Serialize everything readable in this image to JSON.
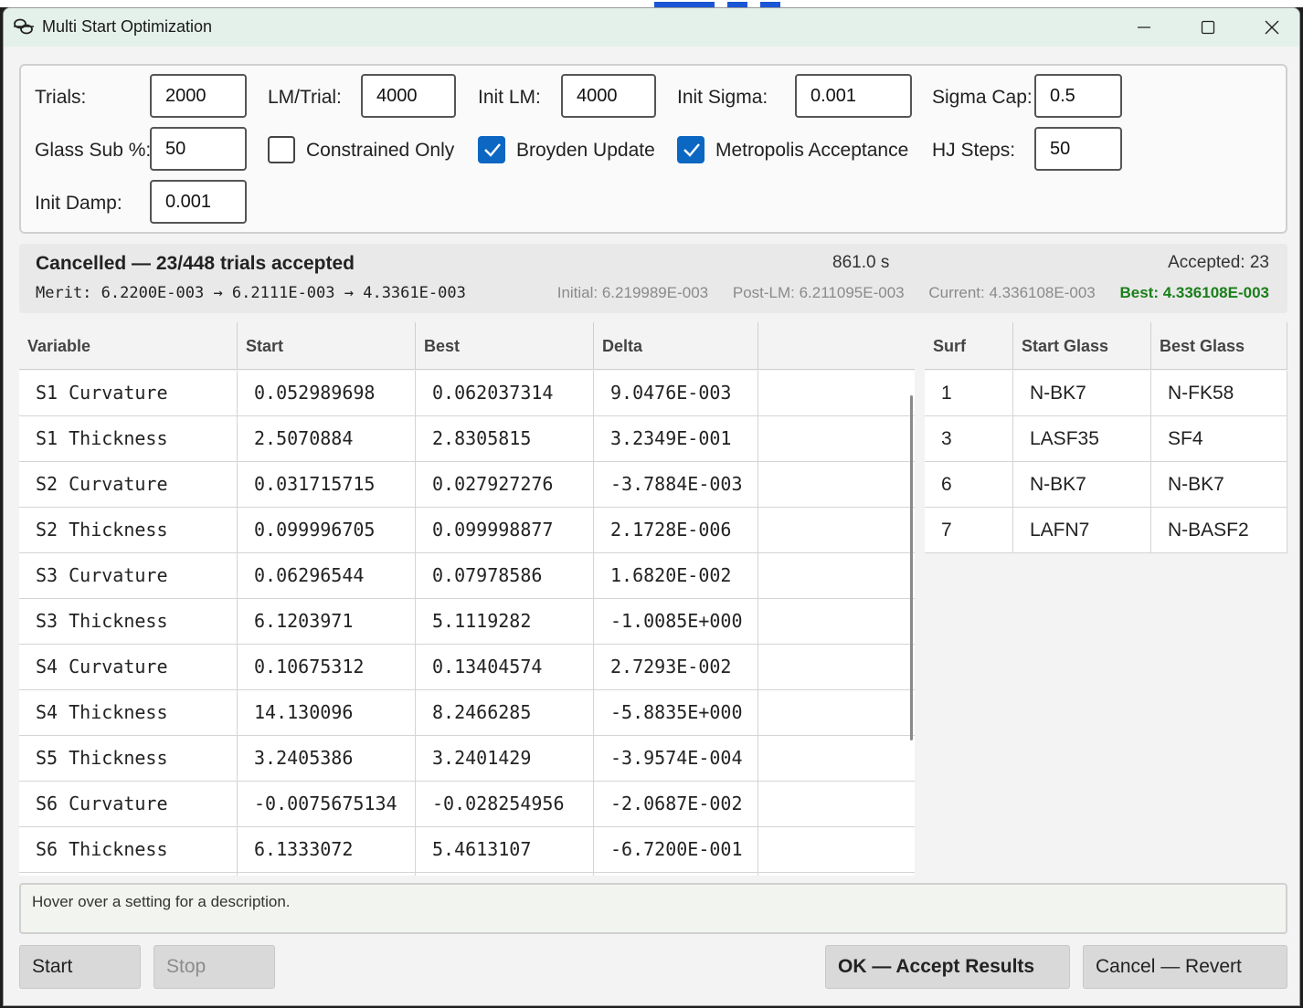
{
  "window": {
    "title": "Multi Start Optimization"
  },
  "settings": {
    "trials_label": "Trials:",
    "trials_value": "2000",
    "lm_trial_label": "LM/Trial:",
    "lm_trial_value": "4000",
    "init_lm_label": "Init LM:",
    "init_lm_value": "4000",
    "init_sigma_label": "Init Sigma:",
    "init_sigma_value": "0.001",
    "sigma_cap_label": "Sigma Cap:",
    "sigma_cap_value": "0.5",
    "glass_sub_label": "Glass Sub %:",
    "glass_sub_value": "50",
    "constrained_label": "Constrained Only",
    "constrained_checked": false,
    "broyden_label": "Broyden Update",
    "broyden_checked": true,
    "metropolis_label": "Metropolis Acceptance",
    "metropolis_checked": true,
    "hj_steps_label": "HJ Steps:",
    "hj_steps_value": "50",
    "init_damp_label": "Init Damp:",
    "init_damp_value": "0.001"
  },
  "status": {
    "main": "Cancelled — 23/448 trials accepted",
    "merit": "Merit: 6.2200E-003 → 6.2111E-003 → 4.3361E-003",
    "elapsed": "861.0 s",
    "accepted": "Accepted: 23",
    "initial": "Initial: 6.219989E-003",
    "post_lm": "Post-LM: 6.211095E-003",
    "current": "Current: 4.336108E-003",
    "best": "Best: 4.336108E-003",
    "best_color": "#1a7f1a"
  },
  "variables": {
    "headers": [
      "Variable",
      "Start",
      "Best",
      "Delta"
    ],
    "rows": [
      [
        "S1 Curvature",
        "0.052989698",
        "0.062037314",
        "9.0476E-003"
      ],
      [
        "S1 Thickness",
        "2.5070884",
        "2.8305815",
        "3.2349E-001"
      ],
      [
        "S2 Curvature",
        "0.031715715",
        "0.027927276",
        "-3.7884E-003"
      ],
      [
        "S2 Thickness",
        "0.099996705",
        "0.099998877",
        "2.1728E-006"
      ],
      [
        "S3 Curvature",
        "0.06296544",
        "0.07978586",
        "1.6820E-002"
      ],
      [
        "S3 Thickness",
        "6.1203971",
        "5.1119282",
        "-1.0085E+000"
      ],
      [
        "S4 Curvature",
        "0.10675312",
        "0.13404574",
        "2.7293E-002"
      ],
      [
        "S4 Thickness",
        "14.130096",
        "8.2466285",
        "-5.8835E+000"
      ],
      [
        "S5 Thickness",
        "3.2405386",
        "3.2401429",
        "-3.9574E-004"
      ],
      [
        "S6 Curvature",
        "-0.0075675134",
        "-0.028254956",
        "-2.0687E-002"
      ],
      [
        "S6 Thickness",
        "6.1333072",
        "5.4613107",
        "-6.7200E-001"
      ]
    ]
  },
  "glass": {
    "headers": [
      "Surf",
      "Start Glass",
      "Best Glass"
    ],
    "rows": [
      [
        "1",
        "N-BK7",
        "N-FK58"
      ],
      [
        "3",
        "LASF35",
        "SF4"
      ],
      [
        "6",
        "N-BK7",
        "N-BK7"
      ],
      [
        "7",
        "LAFN7",
        "N-BASF2"
      ]
    ]
  },
  "description": "Hover over a setting for a description.",
  "buttons": {
    "start": "Start",
    "stop": "Stop",
    "ok": "OK — Accept Results",
    "cancel": "Cancel — Revert"
  },
  "colors": {
    "checkbox_accent": "#0b67c2",
    "titlebar": "#e4f1ea"
  }
}
